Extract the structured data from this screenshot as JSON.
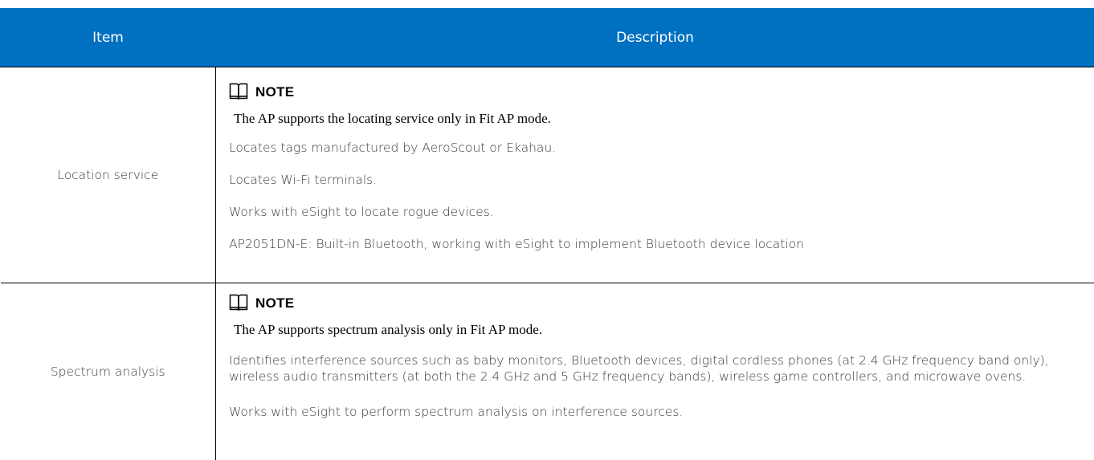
{
  "table": {
    "headers": {
      "item": "Item",
      "description": "Description"
    },
    "colors": {
      "header_bg": "#0070c0",
      "header_text": "#ffffff",
      "border": "#000000",
      "body_text": "#404040"
    },
    "rows": [
      {
        "item": "Location service",
        "note_label": "NOTE",
        "note_icon": "book-icon",
        "note_text": "The AP supports the locating service only in Fit AP mode.",
        "paragraphs": [
          "Locates tags manufactured by AeroScout or Ekahau.",
          "Locates Wi-Fi terminals.",
          "Works with eSight to locate rogue devices.",
          "AP2051DN-E: Built-in Bluetooth, working with eSight to implement Bluetooth device location"
        ]
      },
      {
        "item": "Spectrum analysis",
        "note_label": "NOTE",
        "note_icon": "book-icon",
        "note_text": "The AP supports spectrum analysis only in Fit AP mode.",
        "paragraphs": [
          "Identifies interference sources such as baby monitors, Bluetooth devices, digital cordless phones (at 2.4 GHz frequency band only), wireless audio transmitters (at both the 2.4 GHz and 5 GHz frequency bands), wireless game controllers, and microwave ovens.",
          "Works with eSight to perform spectrum analysis on interference sources."
        ]
      }
    ]
  }
}
